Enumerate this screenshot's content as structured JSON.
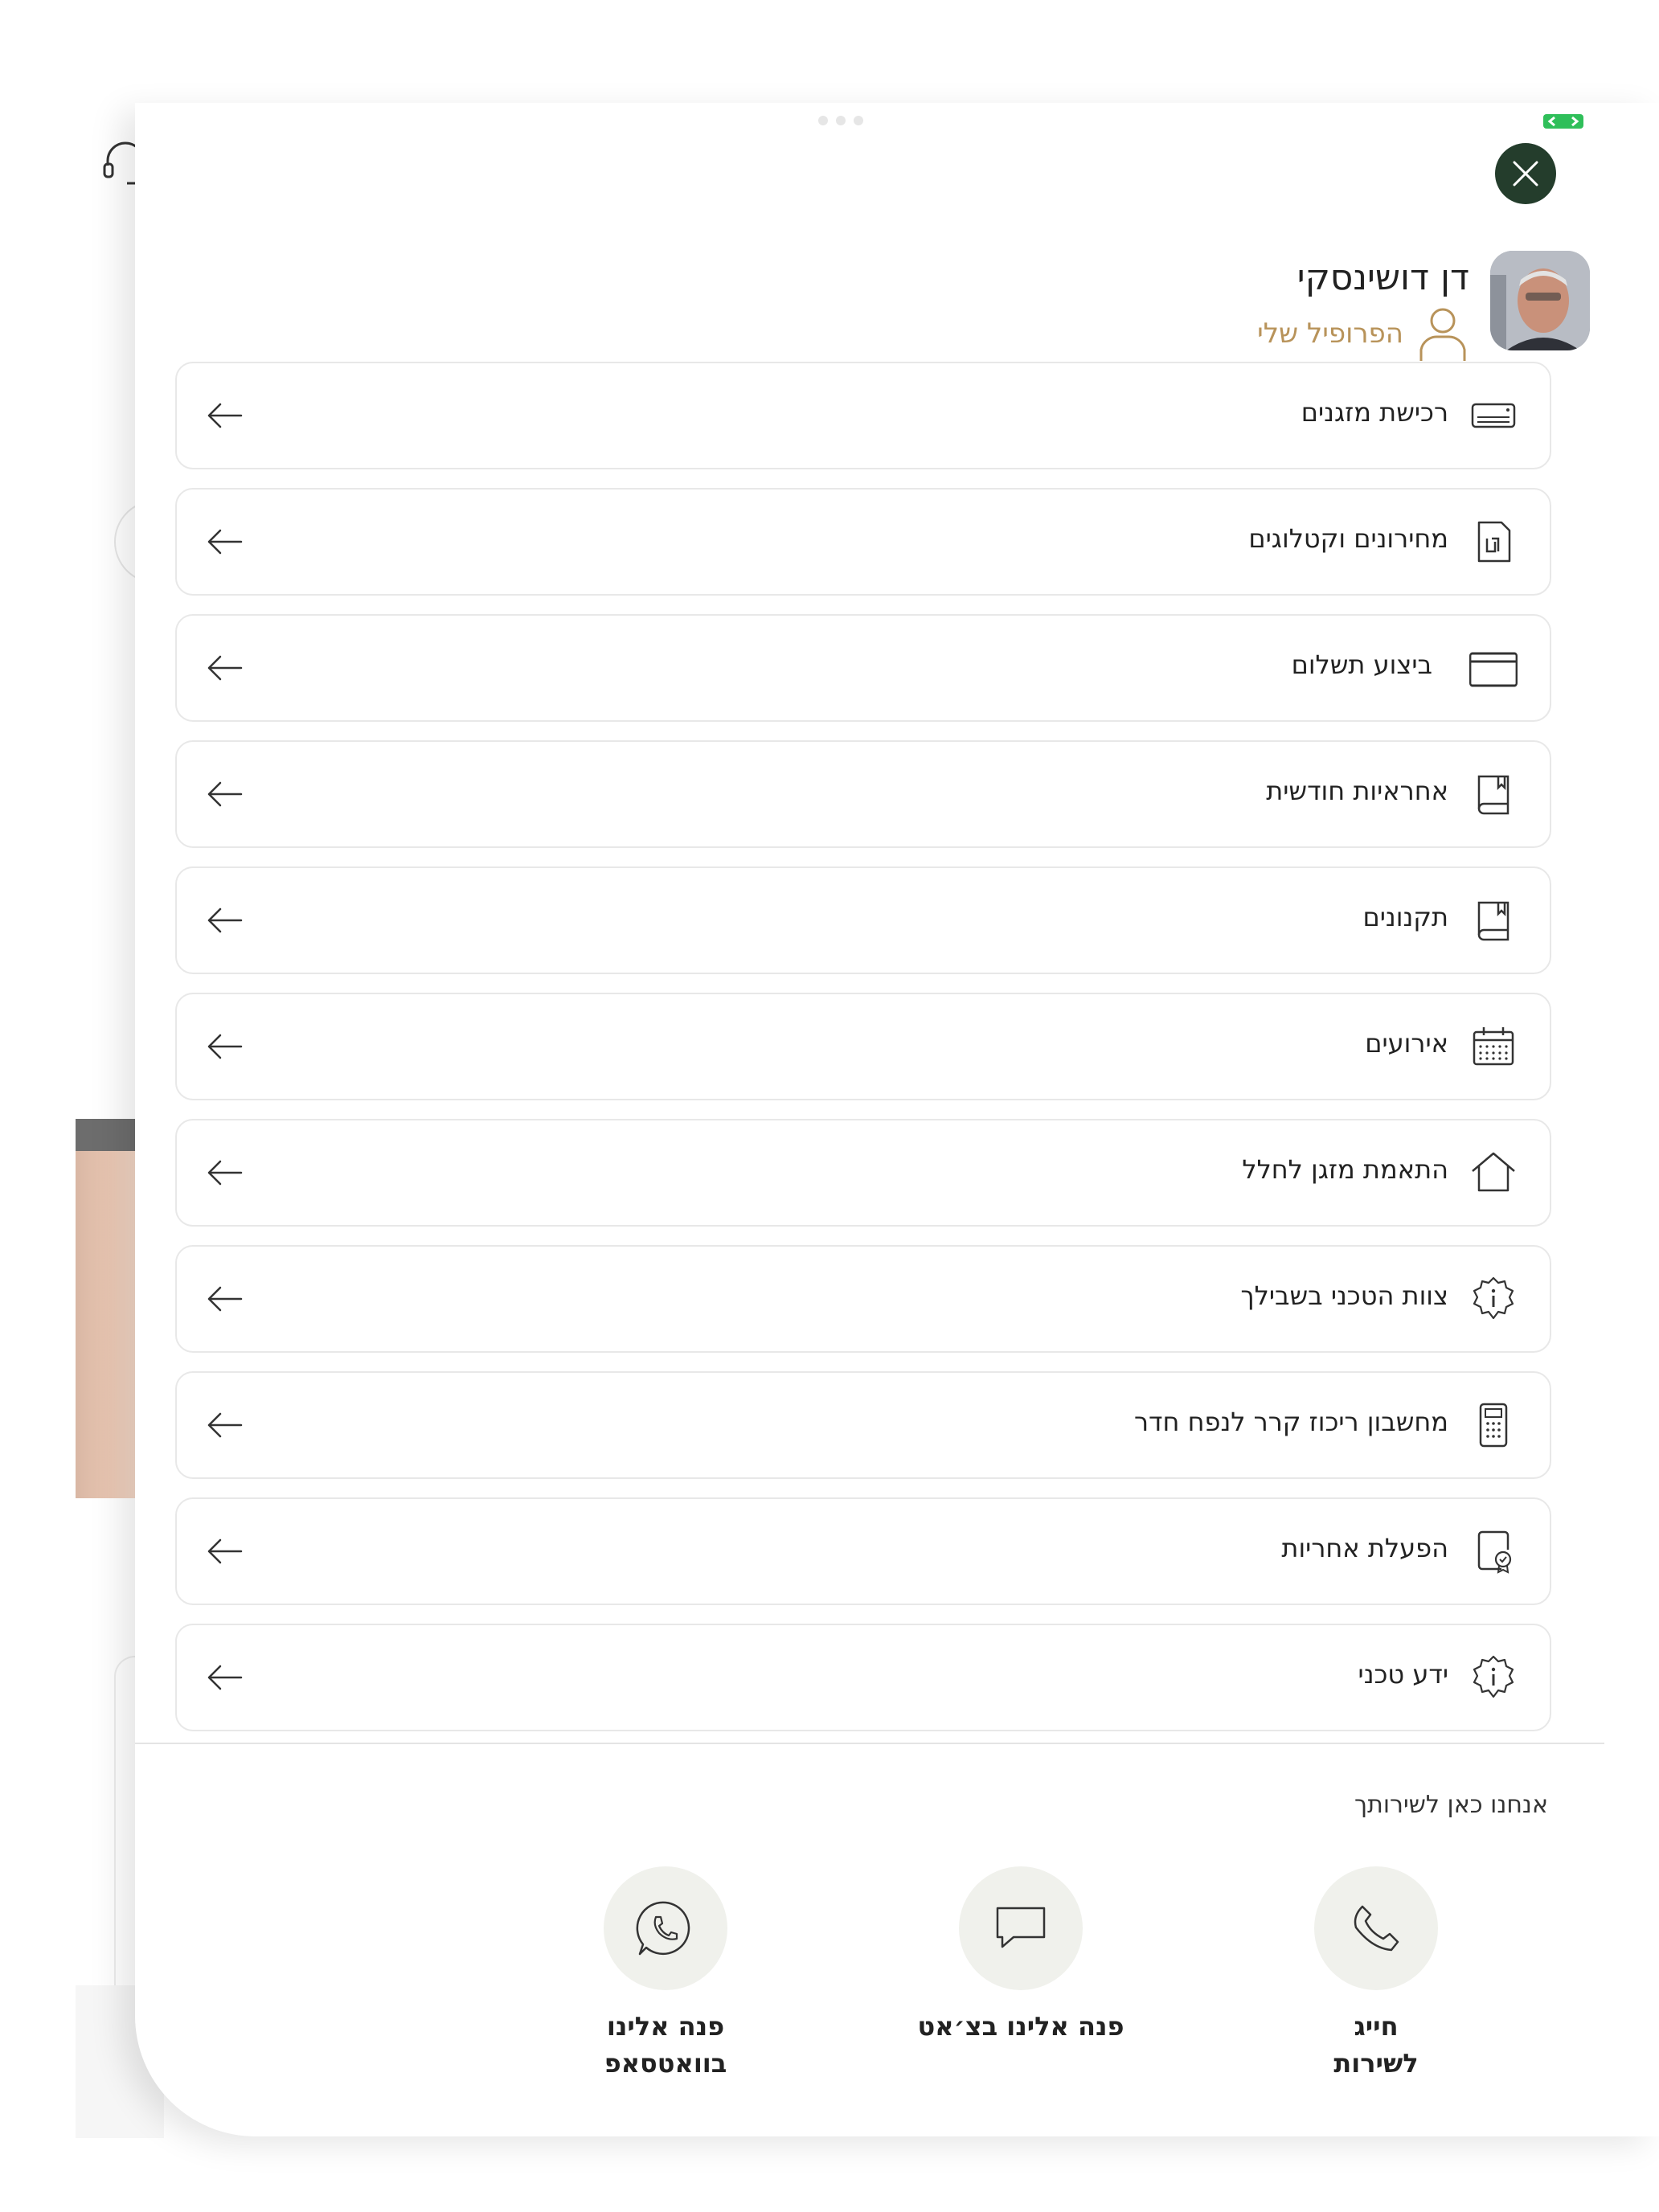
{
  "user": {
    "name": "דן דושינסקי",
    "profile_link": "הפרופיל שלי"
  },
  "menu": {
    "items": [
      {
        "label": "רכישת מזגנים",
        "icon": "ac-unit-icon"
      },
      {
        "label": "מחירונים וקטלוגים",
        "icon": "shekel-document-icon"
      },
      {
        "label": "ביצוע תשלום",
        "icon": "credit-card-icon"
      },
      {
        "label": "אחראיות חודשית",
        "icon": "bookmark-book-icon"
      },
      {
        "label": "תקנונים",
        "icon": "bookmark-book-icon"
      },
      {
        "label": "אירועים",
        "icon": "calendar-icon"
      },
      {
        "label": "התאמת מזגן לחלל",
        "icon": "home-icon"
      },
      {
        "label": "צוות הטכני בשבילך",
        "icon": "info-gear-icon"
      },
      {
        "label": "מחשבון ריכוז קרר לנפח חדר",
        "icon": "calculator-icon"
      },
      {
        "label": "הפעלת אחריות",
        "icon": "certificate-icon"
      },
      {
        "label": "ידע טכני",
        "icon": "info-gear-icon"
      }
    ]
  },
  "support": {
    "title": "אנחנו כאן לשירותך",
    "call": {
      "label_line1": "חייג",
      "label_line2": "לשירות",
      "icon": "phone-icon"
    },
    "chat": {
      "label": "פנה אלינו בצ׳אט",
      "icon": "chat-icon"
    },
    "whatsapp": {
      "label": "פנה אלינו בוואטסאפ",
      "icon": "whatsapp-icon"
    }
  },
  "colors": {
    "close_button": "#243d2c",
    "accent_gold": "#b8935a",
    "contact_circle": "#f0f1ec",
    "status_green": "#2fbf5a"
  }
}
